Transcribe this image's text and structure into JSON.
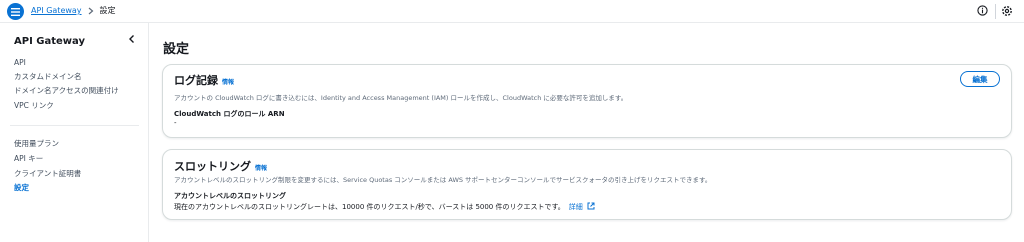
{
  "header": {
    "breadcrumb_service": "API Gateway",
    "breadcrumb_current": "設定"
  },
  "sidebar": {
    "title": "API Gateway",
    "items_group1": [
      "API",
      "カスタムドメイン名",
      "ドメイン名アクセスの関連付け",
      "VPC リンク"
    ],
    "items_group2": [
      "使用量プラン",
      "API キー",
      "クライアント証明書",
      "設定"
    ],
    "active_item": "設定"
  },
  "page": {
    "title": "設定"
  },
  "logging": {
    "title": "ログ記録",
    "info": "情報",
    "description": "アカウントの CloudWatch ログに書き込むには、Identity and Access Management (IAM) ロールを作成し、CloudWatch に必要な許可を追加します。",
    "edit_label": "編集",
    "field_label": "CloudWatch ログのロール ARN",
    "field_value": "-"
  },
  "throttling": {
    "title": "スロットリング",
    "info": "情報",
    "description": "アカウントレベルのスロットリング制限を変更するには、Service Quotas コンソールまたは AWS サポートセンターコンソールでサービスクォータの引き上げをリクエストできます。",
    "field_label": "アカウントレベルのスロットリング",
    "field_value": "現在のアカウントレベルのスロットリングレートは、10000 件のリクエスト/秒で、バーストは 5000 件のリクエストです。",
    "detail_link": "詳細"
  },
  "colors": {
    "accent": "#0972d3",
    "text": "#16191f",
    "muted": "#5f6b7a",
    "border": "#d5dbdb"
  }
}
